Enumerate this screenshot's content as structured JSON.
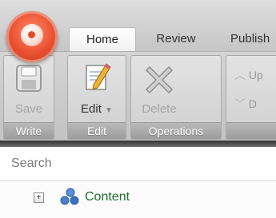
{
  "tabs": [
    {
      "label": "Home",
      "active": true
    },
    {
      "label": "Review",
      "active": false
    },
    {
      "label": "Publish",
      "active": false
    }
  ],
  "ribbon": {
    "write_group": {
      "label": "Write",
      "save_label": "Save"
    },
    "edit_group": {
      "label": "Edit",
      "edit_label": "Edit"
    },
    "operations_group": {
      "label": "Operations",
      "delete_label": "Delete"
    },
    "fourth_group": {
      "up_label": "Up",
      "down_label": "D"
    }
  },
  "search": {
    "placeholder": "Search"
  },
  "tree": {
    "items": [
      {
        "label": "Content",
        "icon": "content-tree-icon",
        "expander": "+"
      }
    ]
  },
  "colors": {
    "orb": "#e8502e",
    "tree_text": "#1f6f2c",
    "group_label_bg": "#a8a8a8",
    "separator": "#333333"
  }
}
